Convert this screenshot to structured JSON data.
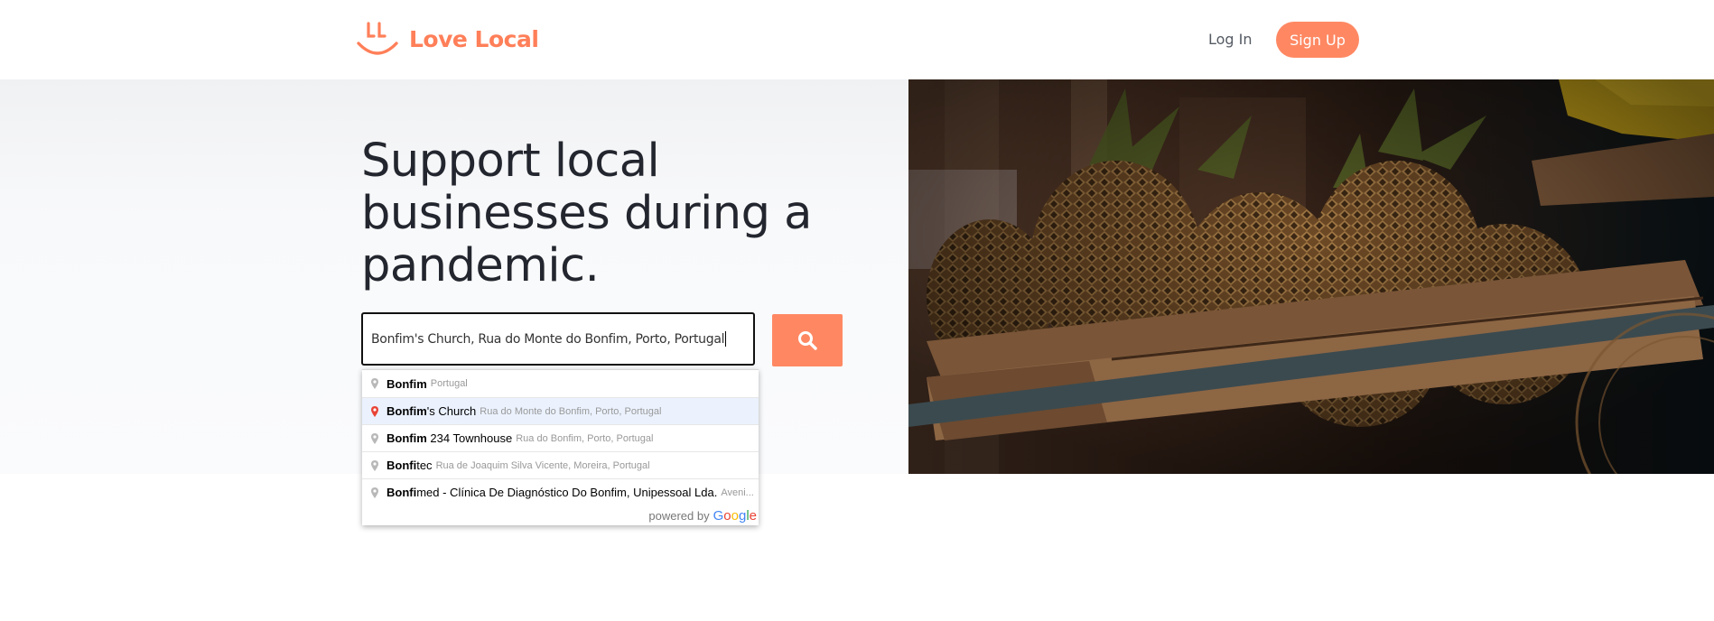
{
  "header": {
    "brand": "Love Local",
    "login_label": "Log In",
    "signup_label": "Sign Up"
  },
  "hero": {
    "headline": "Support local businesses during a pandemic.",
    "search_value": "Bonfim's Church, Rua do Monte do Bonfim, Porto, Portugal"
  },
  "autocomplete": {
    "items": [
      {
        "match": "Bonfim",
        "rest": "",
        "secondary": "Portugal",
        "selected": false
      },
      {
        "match": "Bonfim",
        "rest": "'s Church",
        "secondary": "Rua do Monte do Bonfim, Porto, Portugal",
        "selected": true
      },
      {
        "match": "Bonfim",
        "rest": " 234 Townhouse",
        "secondary": "Rua do Bonfim, Porto, Portugal",
        "selected": false
      },
      {
        "match": "Bonfi",
        "rest": "tec",
        "secondary": "Rua de Joaquim Silva Vicente, Moreira, Portugal",
        "selected": false
      },
      {
        "match": "Bonfi",
        "rest": "med - Clínica De Diagnóstico Do Bonfim, Unipessoal Lda.",
        "secondary": "Aveni...",
        "selected": false
      }
    ],
    "footer_prefix": "powered by",
    "footer_brand": "Google"
  },
  "colors": {
    "accent": "#ff8863",
    "brand_text": "#ff7f59",
    "selected_row": "#ebf2fe",
    "selected_pin": "#e94335"
  },
  "icons": {
    "logo": "smile-logo-icon",
    "search": "search-icon",
    "place": "map-pin-icon"
  }
}
